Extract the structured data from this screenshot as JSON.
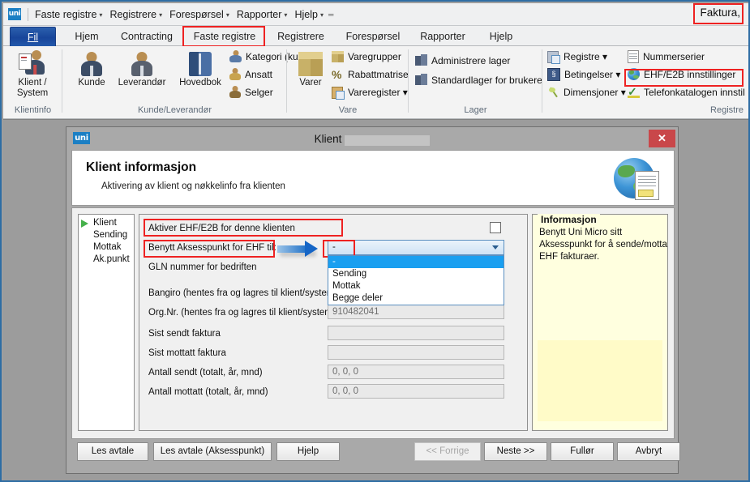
{
  "window": {
    "accent_border": "#2e6da4",
    "top_right_label": "Faktura,"
  },
  "quick_access": {
    "logo": "uni",
    "menus": [
      {
        "label": "Faste registre",
        "caret": "▾"
      },
      {
        "label": "Registrere",
        "caret": "▾"
      },
      {
        "label": "Forespørsel",
        "caret": "▾"
      },
      {
        "label": "Rapporter",
        "caret": "▾"
      },
      {
        "label": "Hjelp",
        "caret": "▾"
      }
    ],
    "overflow": "═"
  },
  "ribbon": {
    "tabs": [
      {
        "label": "Fil",
        "active_file": true
      },
      {
        "label": "Hjem"
      },
      {
        "label": "Contracting"
      },
      {
        "label": "Faste registre",
        "highlighted": true
      },
      {
        "label": "Registrere"
      },
      {
        "label": "Forespørsel"
      },
      {
        "label": "Rapporter"
      },
      {
        "label": "Hjelp"
      }
    ],
    "groups": [
      {
        "label": "Klientinfo",
        "big_buttons": [
          {
            "label": "Klient / System",
            "icon": "user-card-icon"
          }
        ],
        "small_items": []
      },
      {
        "label": "Kunde/Leverandør",
        "big_buttons": [
          {
            "label": "Kunde",
            "icon": "person-icon"
          },
          {
            "label": "Leverandør",
            "icon": "person-icon"
          },
          {
            "label": "Hovedbok",
            "icon": "book-icon"
          }
        ],
        "small_items": [
          {
            "label": "Kategori (kunde)",
            "icon": "people-group-icon"
          },
          {
            "label": "Ansatt",
            "icon": "person-small-icon"
          },
          {
            "label": "Selger",
            "icon": "person-small-icon"
          }
        ]
      },
      {
        "label": "Vare",
        "big_buttons": [
          {
            "label": "Varer",
            "icon": "box-icon"
          }
        ],
        "small_items": [
          {
            "label": "Varegrupper",
            "icon": "boxes-icon"
          },
          {
            "label": "Rabattmatrise",
            "icon": "percent-icon"
          },
          {
            "label": "Vareregister ▾",
            "icon": "register-icon"
          }
        ]
      },
      {
        "label": "Lager",
        "big_buttons": [],
        "small_items": [
          {
            "label": "Administrere lager",
            "icon": "warehouse-icon"
          },
          {
            "label": "Standardlager for brukere",
            "icon": "warehouse-icon"
          }
        ]
      },
      {
        "label": "Registre",
        "big_buttons": [],
        "small_items": [
          {
            "label": "Registre ▾",
            "icon": "register-icon"
          },
          {
            "label": "Betingelser ▾",
            "icon": "conditions-icon"
          },
          {
            "label": "Dimensjoner ▾",
            "icon": "pin-icon"
          },
          {
            "label": "Nummerserier",
            "icon": "numbers-icon"
          },
          {
            "label": "EHF/E2B innstillinger",
            "icon": "globe-icon",
            "highlighted": true
          },
          {
            "label": "Telefonkatalogen innstil",
            "icon": "green-check-icon"
          }
        ]
      }
    ]
  },
  "dialog": {
    "title": "Klient",
    "title_redacted": true,
    "logo": "uni",
    "close_label": "✕",
    "header": {
      "heading": "Klient informasjon",
      "subheading": "Aktivering av klient og nøkkelinfo fra klienten",
      "icon": "globe-document-icon"
    },
    "tree": {
      "items": [
        {
          "label": "Klient",
          "icon": "play-icon",
          "selected": true
        },
        {
          "label": "Sending"
        },
        {
          "label": "Mottak"
        },
        {
          "label": "Ak.punkt"
        }
      ]
    },
    "form": {
      "activate_label": "Aktiver EHF/E2B for denne klienten",
      "activate_checked": false,
      "accesspoint_label": "Benytt Aksesspunkt for EHF til:",
      "accesspoint_value": "-",
      "accesspoint_options": [
        "-",
        "Sending",
        "Mottak",
        "Begge deler"
      ],
      "accesspoint_selected_index": 0,
      "rows": [
        {
          "label": "GLN nummer for bedriften",
          "value": ""
        },
        {
          "label": "Bangiro (hentes fra og lagres til klient/system)",
          "value": ""
        },
        {
          "label": "Org.Nr. (hentes fra og lagres til klient/system)",
          "value": "910482041"
        },
        {
          "label": "Sist sendt faktura",
          "value": ""
        },
        {
          "label": "Sist mottatt faktura",
          "value": ""
        },
        {
          "label": "Antall sendt (totalt, år, mnd)",
          "value": "0, 0, 0"
        },
        {
          "label": "Antall mottatt (totalt, år, mnd)",
          "value": "0, 0, 0"
        }
      ]
    },
    "info": {
      "legend": "Informasjon",
      "lines": [
        "Benytt Uni Micro sitt",
        "Aksesspunkt for å sende/motta",
        "EHF fakturaer."
      ]
    },
    "footer_buttons": [
      {
        "label": "Les avtale",
        "disabled": false
      },
      {
        "label": "Les avtale (Aksesspunkt)",
        "disabled": false
      },
      {
        "label": "Hjelp",
        "disabled": false
      },
      {
        "label": "<< Forrige",
        "disabled": true
      },
      {
        "label": "Neste >>",
        "disabled": false
      },
      {
        "label": "Fullør",
        "disabled": false
      },
      {
        "label": "Avbryt",
        "disabled": false
      }
    ]
  },
  "annotations": {
    "arrow_color": "#1565c6",
    "box_color": "#ee2222"
  }
}
